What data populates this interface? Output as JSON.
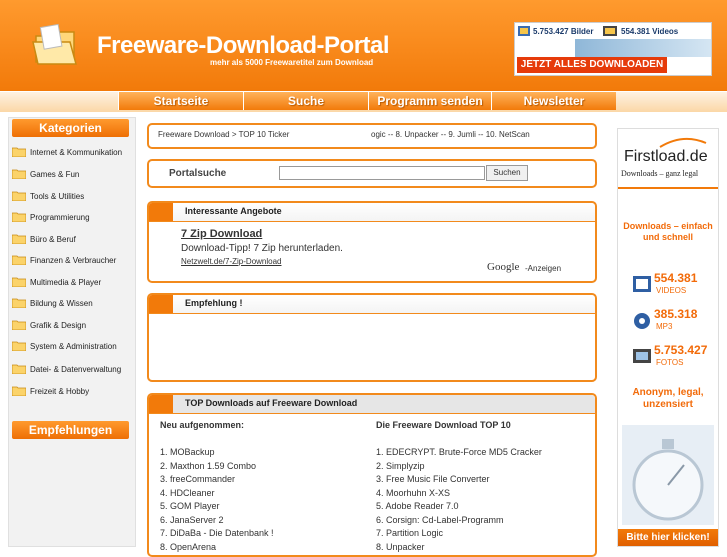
{
  "header": {
    "title": "Freeware-Download-Portal",
    "subtitle": "mehr als 5000 Freewaretitel zum Download",
    "banner": {
      "images_count": "5.753.427 Bilder",
      "videos_count": "554.381 Videos",
      "cta": "JETZT ALLES DOWNLOADEN"
    }
  },
  "nav": {
    "items": [
      "Startseite",
      "Suche",
      "Programm senden",
      "Newsletter"
    ]
  },
  "sidebar": {
    "categories_title": "Kategorien",
    "categories": [
      "Internet & Kommunikation",
      "Games & Fun",
      "Tools & Utilities",
      "Programmierung",
      "Büro & Beruf",
      "Finanzen & Verbraucher",
      "Multimedia & Player",
      "Bildung & Wissen",
      "Grafik & Design",
      "System & Administration",
      "Datei- & Datenverwaltung",
      "Freizeit & Hobby"
    ],
    "recommendations_title": "Empfehlungen"
  },
  "breadcrumb": {
    "path": "Freeware Download > TOP 10 Ticker",
    "ticker": "ogic -- 8. Unpacker -- 9. Jumli -- 10. NetScan"
  },
  "search": {
    "label": "Portalsuche",
    "placeholder": "",
    "button": "Suchen"
  },
  "offers": {
    "title": "Interessante Angebote",
    "ad_title": "7 Zip Download",
    "ad_text": "Download-Tipp! 7 Zip herunterladen.",
    "ad_url": "Netzwelt.de/7-Zip-Download",
    "google_label": "Google",
    "anzeigen": "-Anzeigen"
  },
  "recommendation": {
    "title": "Empfehlung !"
  },
  "top_downloads": {
    "title": "TOP Downloads auf Freeware Download",
    "new_heading": "Neu aufgenommen:",
    "top_heading": "Die Freeware Download TOP 10",
    "new_items": [
      "1. MOBackup",
      "2. Maxthon 1.59 Combo",
      "3. freeCommander",
      "4. HDCleaner",
      "5. GOM Player",
      "6. JanaServer 2",
      "7. DiDaBa - Die Datenbank !",
      "8. OpenArena"
    ],
    "top_items": [
      "1. EDECRYPT. Brute-Force MD5 Cracker",
      "2. Simplyzip",
      "3. Free Music File Converter",
      "4. Moorhuhn X-XS",
      "5. Adobe Reader 7.0",
      "6. Corsign: Cd-Label-Programm",
      "7. Partition Logic",
      "8. Unpacker"
    ]
  },
  "right_ad": {
    "brand": "Firstload.de",
    "brand_sub": "Downloads – ganz legal",
    "slogan": "Downloads – einfach und schnell",
    "stats": [
      {
        "value": "554.381",
        "label": "VIDEOS",
        "icon": "video-icon"
      },
      {
        "value": "385.318",
        "label": "MP3",
        "icon": "music-icon"
      },
      {
        "value": "5.753.427",
        "label": "FOTOS",
        "icon": "photo-icon"
      }
    ],
    "claim": "Anonym, legal, unzensiert",
    "cta": "Bitte hier klicken!"
  },
  "colors": {
    "accent": "#f27a0a",
    "border": "#f28a1c",
    "link": "#333333"
  }
}
